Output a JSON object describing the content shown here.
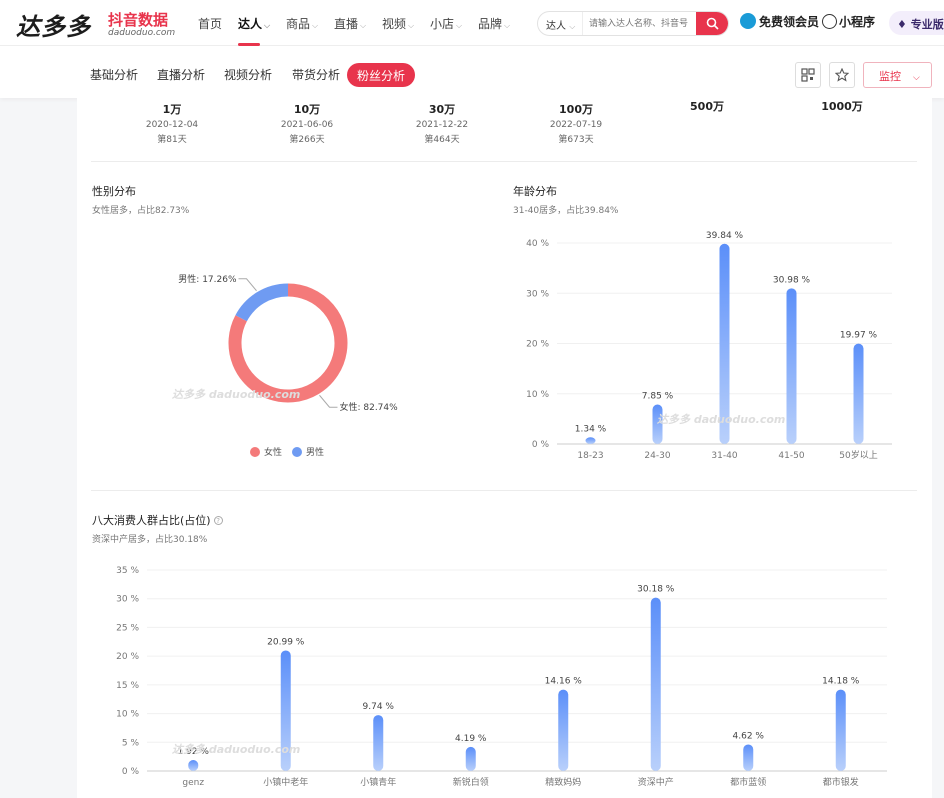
{
  "header": {
    "logo_text": "达多多",
    "logo_cn": "抖音数据",
    "logo_en": "daduoduo.com",
    "nav": [
      {
        "label": "首页",
        "caret": false
      },
      {
        "label": "达人",
        "caret": true,
        "active": true
      },
      {
        "label": "商品",
        "caret": true
      },
      {
        "label": "直播",
        "caret": true
      },
      {
        "label": "视频",
        "caret": true
      },
      {
        "label": "小店",
        "caret": true
      },
      {
        "label": "品牌",
        "caret": true
      }
    ],
    "search_type": "达人",
    "search_placeholder": "请输入达人名称、抖音号",
    "vip_label": "免费领会员",
    "miniprogram_label": "小程序",
    "pro_label": "专业版"
  },
  "subnav": {
    "tabs": [
      "基础分析",
      "直播分析",
      "视频分析",
      "带货分析",
      "粉丝分析"
    ],
    "active_tab": "粉丝分析",
    "monitor_label": "监控"
  },
  "milestones": [
    {
      "value": "1万",
      "date": "2020-12-04",
      "days": "第81天"
    },
    {
      "value": "10万",
      "date": "2021-06-06",
      "days": "第266天"
    },
    {
      "value": "30万",
      "date": "2021-12-22",
      "days": "第464天"
    },
    {
      "value": "100万",
      "date": "2022-07-19",
      "days": "第673天"
    },
    {
      "value": "500万",
      "date": "",
      "days": ""
    },
    {
      "value": "1000万",
      "date": "",
      "days": ""
    }
  ],
  "gender": {
    "title": "性别分布",
    "subtitle": "女性居多，占比82.73%",
    "watermark": "达多多 daduoduo.com"
  },
  "age": {
    "title": "年龄分布",
    "subtitle": "31-40居多，占比39.84%"
  },
  "consumer": {
    "title": "八大消费人群占比(占位)",
    "subtitle": "资深中产居多，占比30.18%"
  },
  "colors": {
    "accent": "#e8344c",
    "female": "#f47a7a",
    "male": "#6f9bf2",
    "bar": "#5b8ff9"
  },
  "chart_data": [
    {
      "type": "pie",
      "categories": [
        "女性",
        "男性"
      ],
      "values": [
        82.74,
        17.26
      ],
      "labels": [
        "女性: 82.74%",
        "男性: 17.26%"
      ],
      "legend": "bottom"
    },
    {
      "type": "bar",
      "categories": [
        "18-23",
        "24-30",
        "31-40",
        "41-50",
        "50岁以上"
      ],
      "values": [
        1.34,
        7.85,
        39.84,
        30.98,
        19.97
      ],
      "data_labels": [
        "1.34 %",
        "7.85 %",
        "39.84 %",
        "30.98 %",
        "19.97 %"
      ],
      "yticks": [
        "0 %",
        "10 %",
        "20 %",
        "30 %",
        "40 %"
      ],
      "ylim": [
        0,
        40
      ]
    },
    {
      "type": "bar",
      "categories": [
        "genz",
        "小镇中老年",
        "小镇青年",
        "新锐白领",
        "精致妈妈",
        "资深中产",
        "都市蓝领",
        "都市银发"
      ],
      "values": [
        1.92,
        20.99,
        9.74,
        4.19,
        14.16,
        30.18,
        4.62,
        14.18
      ],
      "data_labels": [
        "1.92 %",
        "20.99 %",
        "9.74 %",
        "4.19 %",
        "14.16 %",
        "30.18 %",
        "4.62 %",
        "14.18 %"
      ],
      "yticks": [
        "0 %",
        "5 %",
        "10 %",
        "15 %",
        "20 %",
        "25 %",
        "30 %",
        "35 %"
      ],
      "ylim": [
        0,
        35
      ]
    }
  ]
}
